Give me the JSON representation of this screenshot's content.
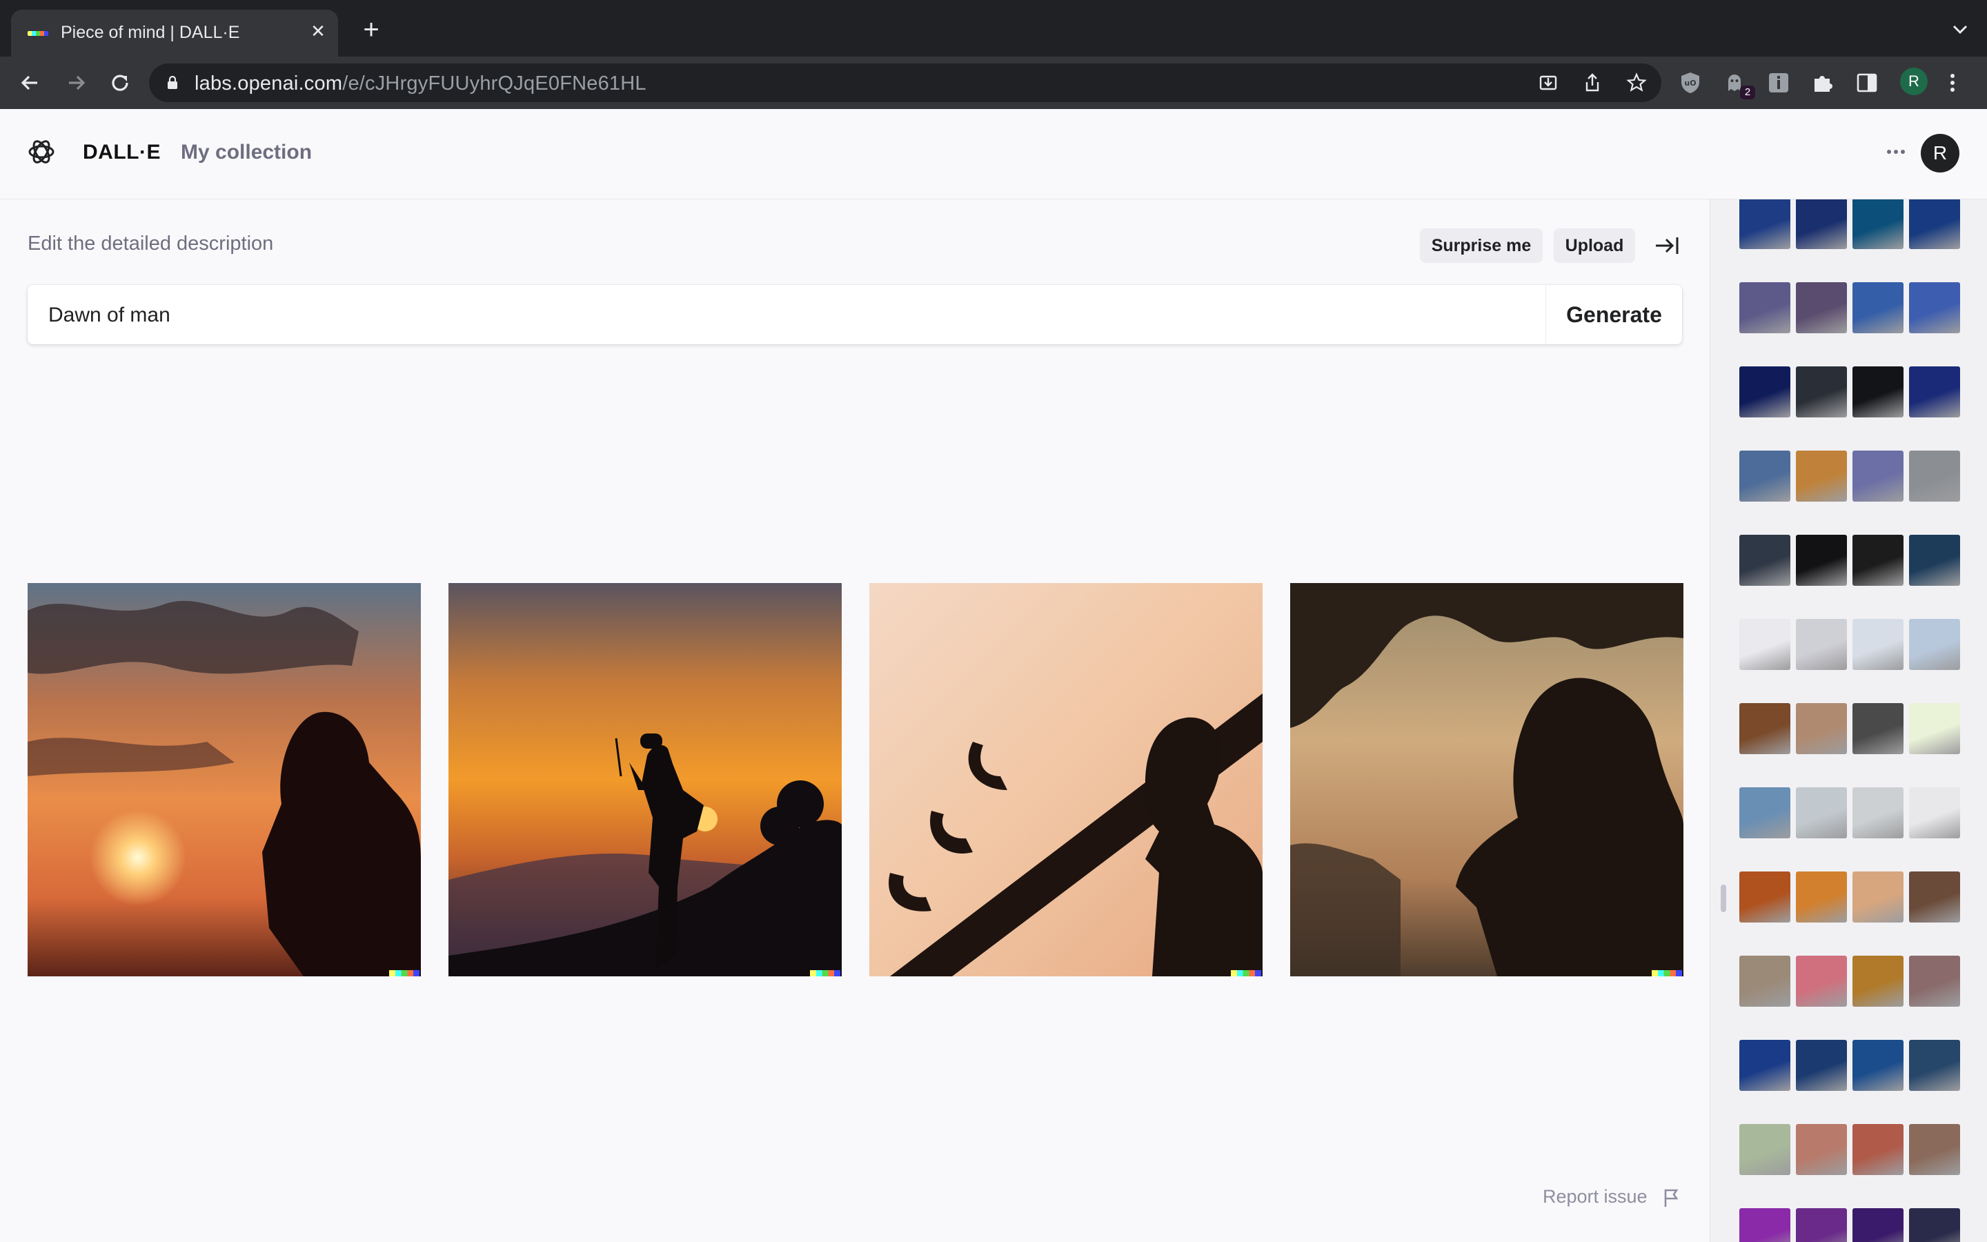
{
  "browser": {
    "tab_title": "Piece of mind | DALL·E",
    "url_host": "labs.openai.com",
    "url_path": "/e/cJHrgyFUUyhrQJqE0FNe61HL",
    "profile_initial": "R",
    "extension_badge": "2"
  },
  "header": {
    "brand": "DALL·E",
    "collection_link": "My collection",
    "avatar_initial": "R"
  },
  "editor": {
    "description_label": "Edit the detailed description",
    "surprise_label": "Surprise me",
    "upload_label": "Upload",
    "prompt_value": "Dawn of man",
    "generate_label": "Generate"
  },
  "results": [
    {
      "name": "sunset-hooded-figure"
    },
    {
      "name": "hiker-silhouette-sunset"
    },
    {
      "name": "man-profile-rooftop"
    },
    {
      "name": "bearded-man-tree-silhouette"
    }
  ],
  "footer": {
    "report_label": "Report issue"
  },
  "history": {
    "groups": [
      {
        "theme": "fishbowls",
        "colors": [
          "#1d3c84",
          "#1a2f6e",
          "#0b4f7a",
          "#173a80"
        ]
      },
      {
        "theme": "cats-ufo",
        "colors": [
          "#5d5a8a",
          "#5a4c6e",
          "#345ea8",
          "#3d5db0"
        ]
      },
      {
        "theme": "blue-streaks",
        "colors": [
          "#101c5a",
          "#2a2e36",
          "#121418",
          "#1a2a78"
        ]
      },
      {
        "theme": "lakes-dusk",
        "colors": [
          "#4d6c99",
          "#c0823a",
          "#6b6fa6",
          "#8b8f94"
        ]
      },
      {
        "theme": "dark-portraits",
        "colors": [
          "#2f3846",
          "#121214",
          "#1c1c1c",
          "#1c3c5a"
        ]
      },
      {
        "theme": "machine-sketches",
        "colors": [
          "#e9e9ee",
          "#cfcfd6",
          "#d7dde6",
          "#b8c8dc"
        ]
      },
      {
        "theme": "trust-signs",
        "colors": [
          "#7a4a2a",
          "#b08a70",
          "#4a4a4a",
          "#eaf2d8"
        ]
      },
      {
        "theme": "comics",
        "colors": [
          "#6a8fb4",
          "#c2c9ce",
          "#ccd0d2",
          "#e8e8ea"
        ]
      },
      {
        "theme": "silhouettes",
        "colors": [
          "#b0521e",
          "#d2802e",
          "#d7a67e",
          "#6a4a38"
        ]
      },
      {
        "theme": "sunsets",
        "colors": [
          "#9b8a78",
          "#d0707e",
          "#b07a2a",
          "#8a6a6a"
        ]
      },
      {
        "theme": "blue-poster",
        "colors": [
          "#1a3c88",
          "#1a3a70",
          "#1b4c8c",
          "#26466a"
        ]
      },
      {
        "theme": "cartoon-scenes",
        "colors": [
          "#a8b89a",
          "#b87a6a",
          "#b05a4a",
          "#8a6a5a"
        ]
      },
      {
        "theme": "purple-figures",
        "colors": [
          "#8a2aa8",
          "#6a2a8a",
          "#3a1a6a",
          "#2a2a4a"
        ]
      }
    ]
  }
}
